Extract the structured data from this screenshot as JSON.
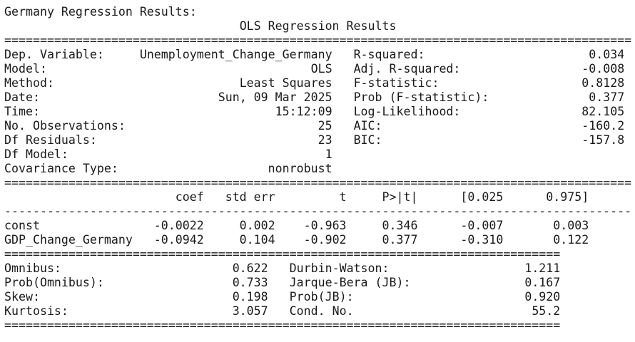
{
  "heading": "Germany Regression Results:",
  "table_title": "OLS Regression Results",
  "summary": {
    "left": [
      {
        "label": "Dep. Variable:",
        "value": "Unemployment_Change_Germany"
      },
      {
        "label": "Model:",
        "value": "OLS"
      },
      {
        "label": "Method:",
        "value": "Least Squares"
      },
      {
        "label": "Date:",
        "value": "Sun, 09 Mar 2025"
      },
      {
        "label": "Time:",
        "value": "15:12:09"
      },
      {
        "label": "No. Observations:",
        "value": "25"
      },
      {
        "label": "Df Residuals:",
        "value": "23"
      },
      {
        "label": "Df Model:",
        "value": "1"
      },
      {
        "label": "Covariance Type:",
        "value": "nonrobust"
      }
    ],
    "right": [
      {
        "label": "R-squared:",
        "value": "0.034"
      },
      {
        "label": "Adj. R-squared:",
        "value": "-0.008"
      },
      {
        "label": "F-statistic:",
        "value": "0.8128"
      },
      {
        "label": "Prob (F-statistic):",
        "value": "0.377"
      },
      {
        "label": "Log-Likelihood:",
        "value": "82.105"
      },
      {
        "label": "AIC:",
        "value": "-160.2"
      },
      {
        "label": "BIC:",
        "value": "-157.8"
      }
    ]
  },
  "coef_table": {
    "headers": [
      "coef",
      "std err",
      "t",
      "P>|t|",
      "[0.025",
      "0.975]"
    ],
    "rows": [
      {
        "name": "const",
        "values": [
          "-0.0022",
          "0.002",
          "-0.963",
          "0.346",
          "-0.007",
          "0.003"
        ]
      },
      {
        "name": "GDP_Change_Germany",
        "values": [
          "-0.0942",
          "0.104",
          "-0.902",
          "0.377",
          "-0.310",
          "0.122"
        ]
      }
    ]
  },
  "diagnostics": [
    {
      "l_label": "Omnibus:",
      "l_value": "0.622",
      "r_label": "Durbin-Watson:",
      "r_value": "1.211"
    },
    {
      "l_label": "Prob(Omnibus):",
      "l_value": "0.733",
      "r_label": "Jarque-Bera (JB):",
      "r_value": "0.167"
    },
    {
      "l_label": "Skew:",
      "l_value": "0.198",
      "r_label": "Prob(JB):",
      "r_value": "0.920"
    },
    {
      "l_label": "Kurtosis:",
      "l_value": "3.057",
      "r_label": "Cond. No.",
      "r_value": "55.2"
    }
  ]
}
